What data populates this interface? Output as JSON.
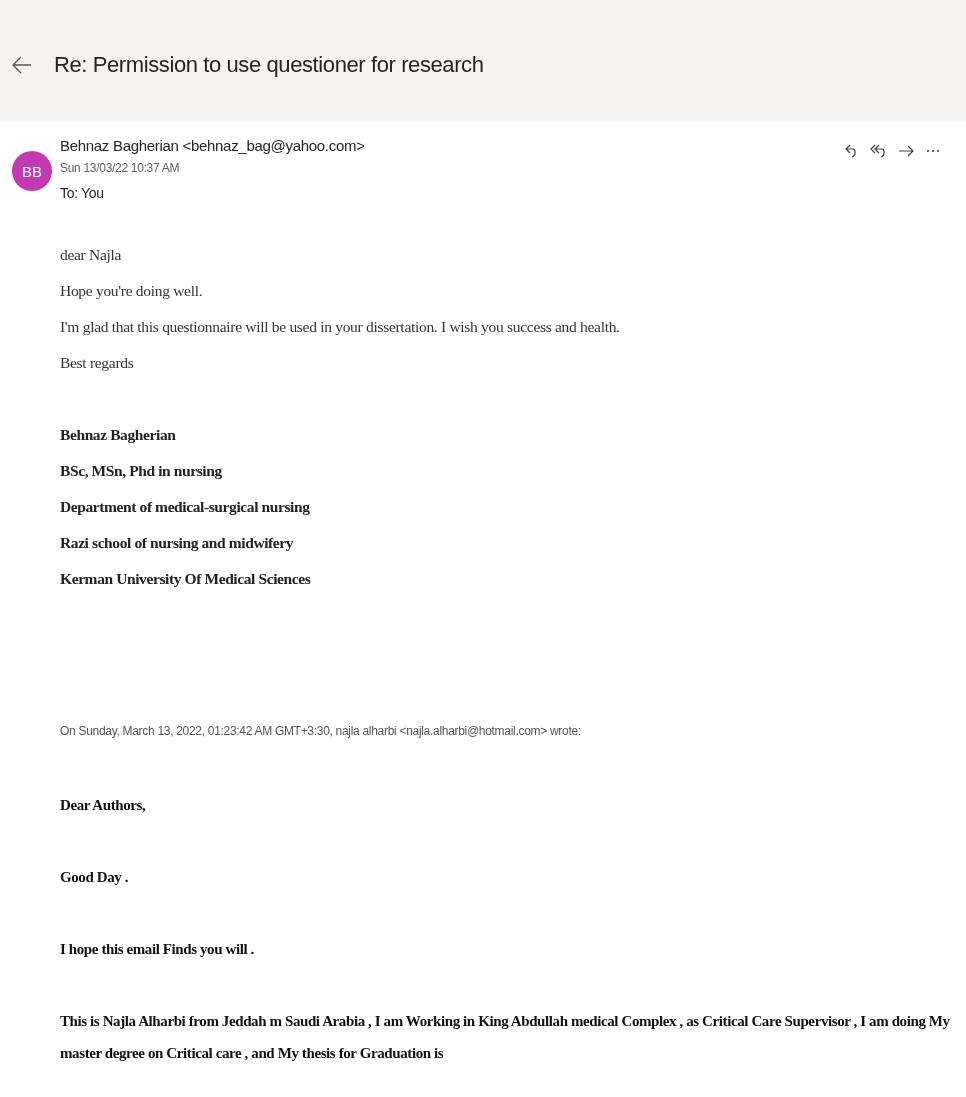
{
  "header": {
    "title": "Re: Permission to use questioner for research"
  },
  "message": {
    "avatar_initials": "BB",
    "sender": "Behnaz Bagherian <behnaz_bag@yahoo.com>",
    "date": "Sun 13/03/22 10:37 AM",
    "recipients": "To: You",
    "actions": [
      {
        "kind": "reply"
      },
      {
        "kind": "reply-all"
      },
      {
        "kind": "forward"
      },
      {
        "kind": "more"
      }
    ]
  },
  "body": [
    {
      "kind": "reply",
      "lines": [
        "dear Najla",
        "Hope you're doing well.",
        "I'm glad that this questionnaire will be used in your dissertation. I wish you success and health.",
        "Best regards"
      ]
    },
    {
      "kind": "signature",
      "lines": [
        "Behnaz Bagherian",
        "BSc, MSn, Phd in nursing",
        "Department of medical-surgical nursing",
        "Razi school of nursing and midwifery",
        "Kerman University Of Medical Sciences"
      ]
    },
    {
      "kind": "quote-header",
      "lines": [
        "On Sunday, March 13, 2022, 01:23:42 AM GMT+3:30, najla alharbi <najla.alharbi@hotmail.com> wrote:"
      ]
    },
    {
      "kind": "quoted",
      "lines": [
        "Dear Authors,",
        "Good Day .",
        "I hope this email Finds you will .",
        "This is Najla Alharbi from Jeddah m Saudi Arabia ,  I am Working in King Abdullah medical Complex , as Critical Care Supervisor , I am doing My master degree on Critical care , and My thesis for Graduation is"
      ]
    }
  ]
}
